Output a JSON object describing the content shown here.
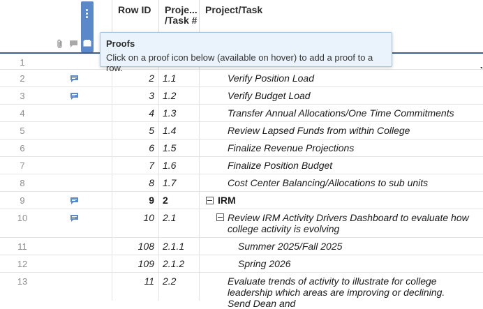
{
  "header": {
    "row_id": "Row ID",
    "project_task_num": "Proje... /Task #",
    "project_task": "Project/Task"
  },
  "tooltip": {
    "title": "Proofs",
    "text": "Click on a proof icon below (available on hover) to add a proof to a row."
  },
  "rows": [
    {
      "num": "1",
      "row_id": "",
      "pt_num": "",
      "task": "",
      "comment": false
    },
    {
      "num": "2",
      "row_id": "2",
      "pt_num": "1.1",
      "task": "Verify Position Load",
      "comment": true
    },
    {
      "num": "3",
      "row_id": "3",
      "pt_num": "1.2",
      "task": "Verify Budget Load",
      "comment": true
    },
    {
      "num": "4",
      "row_id": "4",
      "pt_num": "1.3",
      "task": "Transfer Annual Allocations/One Time Commitments",
      "comment": false
    },
    {
      "num": "5",
      "row_id": "5",
      "pt_num": "1.4",
      "task": "Review Lapsed Funds from within College",
      "comment": false
    },
    {
      "num": "6",
      "row_id": "6",
      "pt_num": "1.5",
      "task": "Finalize Revenue Projections",
      "comment": false
    },
    {
      "num": "7",
      "row_id": "7",
      "pt_num": "1.6",
      "task": "Finalize Position Budget",
      "comment": false
    },
    {
      "num": "8",
      "row_id": "8",
      "pt_num": "1.7",
      "task": "Cost Center Balancing/Allocations to sub units",
      "comment": false
    },
    {
      "num": "9",
      "row_id": "9",
      "pt_num": "2",
      "task": "IRM",
      "comment": true
    },
    {
      "num": "10",
      "row_id": "10",
      "pt_num": "2.1",
      "task": "Review IRM Activity Drivers Dashboard to evaluate how college activity is evolving",
      "comment": true
    },
    {
      "num": "11",
      "row_id": "108",
      "pt_num": "2.1.1",
      "task": "Summer 2025/Fall 2025",
      "comment": false
    },
    {
      "num": "12",
      "row_id": "109",
      "pt_num": "2.1.2",
      "task": "Spring 2026",
      "comment": false
    },
    {
      "num": "13",
      "row_id": "11",
      "pt_num": "2.2",
      "task": "Evaluate trends of activity to illustrate for college leadership which areas are improving or declining. Send Dean and",
      "comment": false
    }
  ],
  "colors": {
    "accent": "#5b88c9",
    "header_rule": "#3d5e8c",
    "tooltip_bg": "#eaf3fb"
  }
}
